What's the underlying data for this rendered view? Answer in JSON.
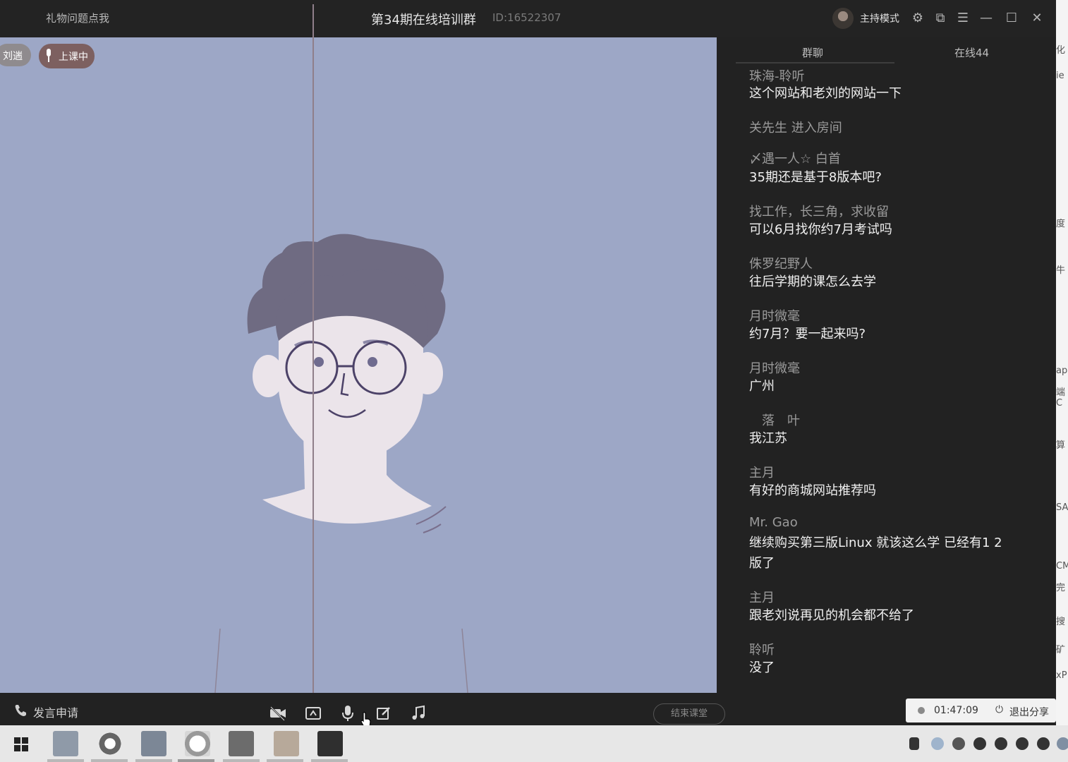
{
  "topbar": {
    "gift_link": "礼物问题点我",
    "room_title": "第34期在线培训群",
    "room_id": "ID:16522307",
    "host_mode": "主持模式"
  },
  "stage": {
    "teacher_tag": "刘遄",
    "live_badge": "上课中"
  },
  "chat": {
    "tabs": [
      {
        "label": "群聊"
      },
      {
        "label": "在线44"
      }
    ],
    "messages": [
      {
        "name": "珠海-聆听",
        "text": "这个网站和老刘的网站一下"
      },
      {
        "name": "关先生 进入房间",
        "text": ""
      },
      {
        "name": "〆遇一人☆ 白首",
        "text": "35期还是基于8版本吧?"
      },
      {
        "name": "找工作，长三角，求收留",
        "text": "可以6月找你约7月考试吗"
      },
      {
        "name": "侏罗纪野人",
        "text": "往后学期的课怎么去学"
      },
      {
        "name": "月时微毫",
        "text": "约7月？要一起来吗?"
      },
      {
        "name": "月时微毫",
        "text": "广州"
      },
      {
        "name": "　落　叶",
        "text": "我江苏"
      },
      {
        "name": "主月",
        "text": "有好的商城网站推荐吗"
      },
      {
        "name": "Mr. Gao",
        "text": "继续购买第三版Linux 就该这么学 已经有1 2",
        "text2": "版了"
      },
      {
        "name": "主月",
        "text": "跟老刘说再见的机会都不给了"
      },
      {
        "name": "聆听",
        "text": "没了"
      }
    ]
  },
  "controls": {
    "speak_request": "发言申请",
    "end_class": "结束课堂",
    "timer": "01:47:09",
    "exit_share": "退出分享"
  },
  "side_strip": {
    "fragments": [
      "化",
      "ie",
      "度",
      "牛",
      "ap",
      "端C",
      "算",
      "SA",
      "CM",
      "完",
      "搜",
      "矿",
      "xP"
    ]
  },
  "colors": {
    "stage_bg": "#9da7c6",
    "chat_bg": "#222222",
    "live_badge": "#7d6060"
  }
}
